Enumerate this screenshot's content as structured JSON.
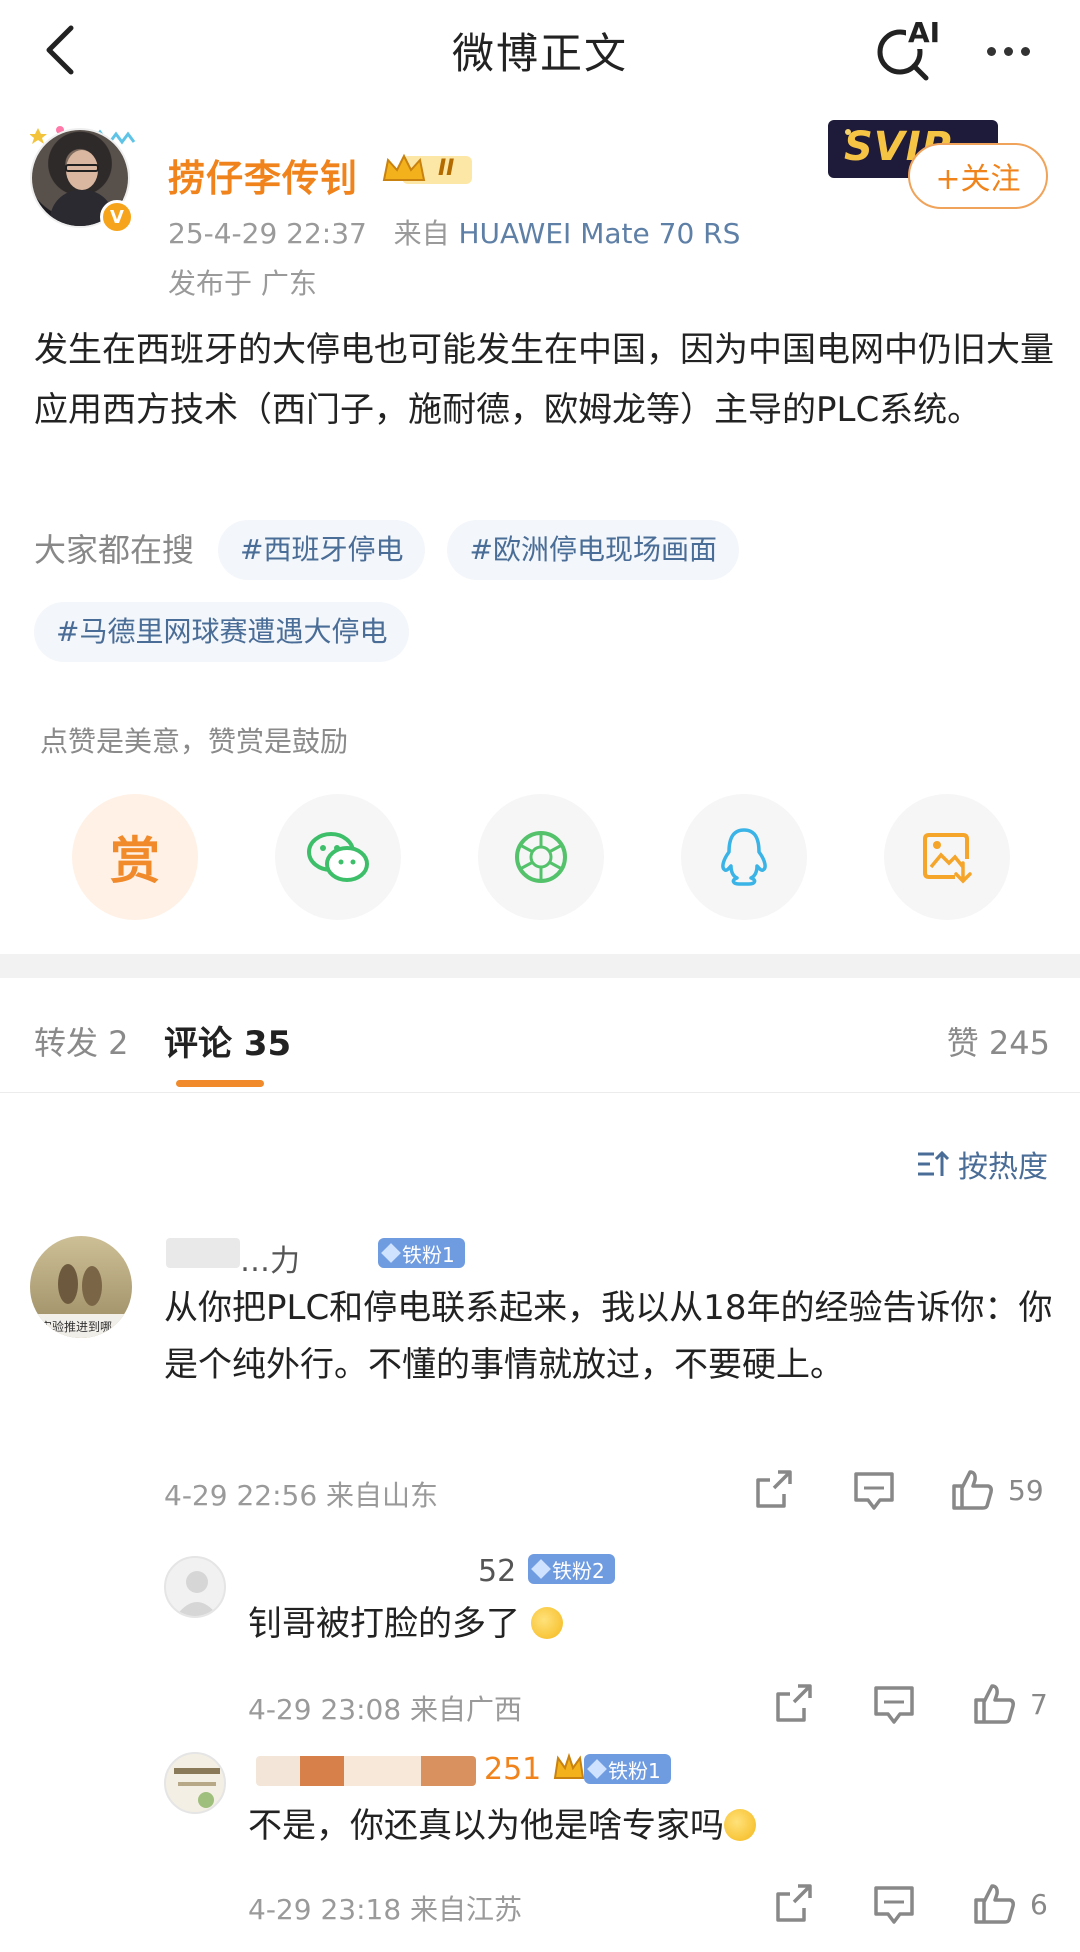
{
  "nav": {
    "title": "微博正文",
    "ai_label": "AI"
  },
  "post": {
    "author": "捞仔李传钊",
    "level_badge": "II",
    "date": "25-4-29 22:37",
    "source_prefix": "来自",
    "device": "HUAWEI Mate 70 RS",
    "location": "发布于 广东",
    "follow_label": "+关注",
    "svip_label": "SVIP",
    "text": "发生在西班牙的大停电也可能发生在中国，因为中国电网中仍旧大量应用西方技术（西门子，施耐德，欧姆龙等）主导的PLC系统。",
    "search_label": "大家都在搜",
    "tags": [
      "#西班牙停电",
      "#欧洲停电现场画面",
      "#马德里网球赛遭遇大停电"
    ],
    "reward_tip": "点赞是美意，赞赏是鼓励",
    "reward_char": "赏"
  },
  "tabs": {
    "repost": "转发 2",
    "comment": "评论 35",
    "likes": "赞 245"
  },
  "sort_label": "按热度",
  "comments": [
    {
      "name": "…力",
      "badge": "铁粉1",
      "text": "从你把PLC和停电联系起来，我以从18年的经验告诉你：你是个纯外行。不懂的事情就放过，不要硬上。",
      "meta": "4-29 22:56 来自山东",
      "likes": "59",
      "avatar_caption": "实验推进到哪"
    },
    {
      "name": "52",
      "badge": "铁粉2",
      "text": "钊哥被打脸的多了",
      "meta": "4-29 23:08 来自广西",
      "likes": "7"
    },
    {
      "name": "251",
      "badge": "铁粉1",
      "text": "不是，你还真以为他是啥专家吗",
      "meta": "4-29 23:18 来自江苏",
      "likes": "6"
    }
  ],
  "colors": {
    "accent": "#f08a2a",
    "link": "#4a6d97",
    "tag_bg": "#f3f6fa",
    "fan_badge": "#6f9be0"
  }
}
